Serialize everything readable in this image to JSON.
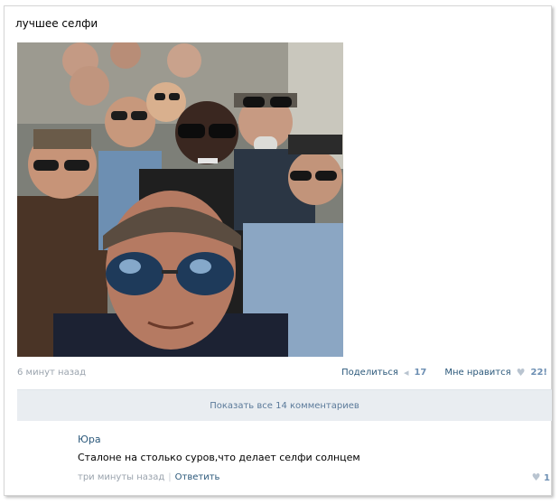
{
  "post": {
    "text": "лучшее селфи",
    "time": "6 минут назад",
    "share_label": "Поделиться",
    "share_count": "17",
    "like_label": "Мне нравится",
    "like_count": "22!",
    "show_all_comments": "Показать все 14 комментариев"
  },
  "comment": {
    "author": "Юра",
    "text": "Сталоне на столько суров,что делает селфи солнцем",
    "time": "три минуты назад",
    "reply_label": "Ответить",
    "like_count": "1"
  },
  "icons": {
    "share": "megaphone-icon",
    "like": "heart-icon",
    "comment_like": "heart-icon"
  },
  "colors": {
    "link": "#2b587a",
    "muted": "#9aa3ad",
    "show_all_bg": "#e9edf1"
  }
}
